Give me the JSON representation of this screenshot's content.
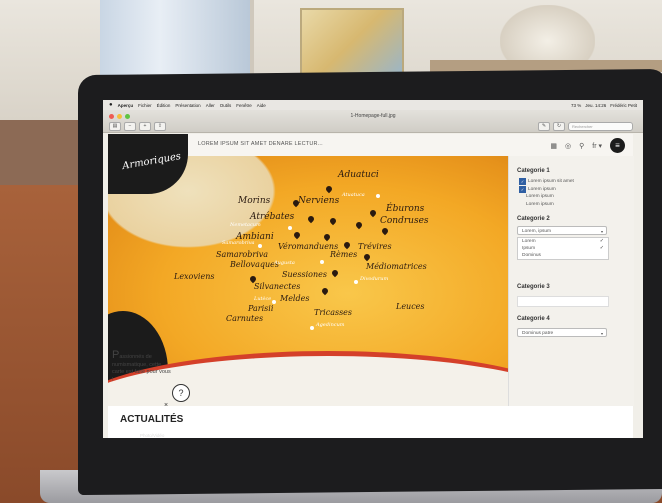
{
  "menubar": {
    "apple": "",
    "items": [
      "Aperçu",
      "Fichier",
      "Édition",
      "Présentation",
      "Aller",
      "Outils",
      "Fenêtre",
      "Aide"
    ],
    "clock": "Jeu. 14:26",
    "user": "Frédéric Petit",
    "battery": "73 %"
  },
  "window": {
    "title": "1-Homepage-full.jpg",
    "search_placeholder": "Rechercher"
  },
  "site": {
    "logo": "Armoriques",
    "headline": "LOREM IPSUM SIT AMET DENARE LECTUR...",
    "language": "fr",
    "intro_cap": "P",
    "intro_text": "assionnés de numismatique, cette carte est faite pour vous !",
    "help": "?",
    "close": "×",
    "news": "ACTUALITÉS"
  },
  "map": {
    "tribes": [
      {
        "name": "Aduatuci",
        "size": 9
      },
      {
        "name": "Morins",
        "size": 9
      },
      {
        "name": "Nerviens",
        "size": 9
      },
      {
        "name": "Éburons",
        "size": 9
      },
      {
        "name": "Atrébates",
        "size": 9
      },
      {
        "name": "Condruses",
        "size": 9
      },
      {
        "name": "Ambiani",
        "size": 9
      },
      {
        "name": "Véromanduens",
        "size": 8
      },
      {
        "name": "Trévires",
        "size": 8
      },
      {
        "name": "Samarobriva",
        "size": 8
      },
      {
        "name": "Rèmes",
        "size": 8
      },
      {
        "name": "Bellovaques",
        "size": 8
      },
      {
        "name": "Médiomatrices",
        "size": 8
      },
      {
        "name": "Lexoviens",
        "size": 8
      },
      {
        "name": "Suessiones",
        "size": 8
      },
      {
        "name": "Silvanectes",
        "size": 8
      },
      {
        "name": "Meldes",
        "size": 8
      },
      {
        "name": "Leuces",
        "size": 8
      },
      {
        "name": "Parisii",
        "size": 8
      },
      {
        "name": "Carnutes",
        "size": 8
      },
      {
        "name": "Tricasses",
        "size": 8
      }
    ],
    "small_labels": [
      "Atuatuca",
      "Nemetacum",
      "Samarobriva",
      "Augusta",
      "Divodurum",
      "Lutèce",
      "Agedincum"
    ]
  },
  "sidebar": {
    "cat1": "Categorie 1",
    "cat1_options": [
      {
        "label": "Lorem ipsum sit amet",
        "checked": true
      },
      {
        "label": "Lorem ipsum",
        "checked": true
      },
      {
        "label": "Lorem ipsum",
        "checked": false
      },
      {
        "label": "Lorem ipsum",
        "checked": false
      }
    ],
    "cat2": "Categorie 2",
    "cat2_select": "Lorem, ipsum",
    "cat2_options": [
      {
        "label": "Lorem",
        "checked": true
      },
      {
        "label": "Ipsum",
        "checked": true
      },
      {
        "label": "Dominus",
        "checked": false
      }
    ],
    "cat3": "Categorie 3",
    "cat4": "Categorie 4",
    "cat4_select": "Dominus patre"
  },
  "dock": {
    "label": "Photo/Vidéo"
  }
}
